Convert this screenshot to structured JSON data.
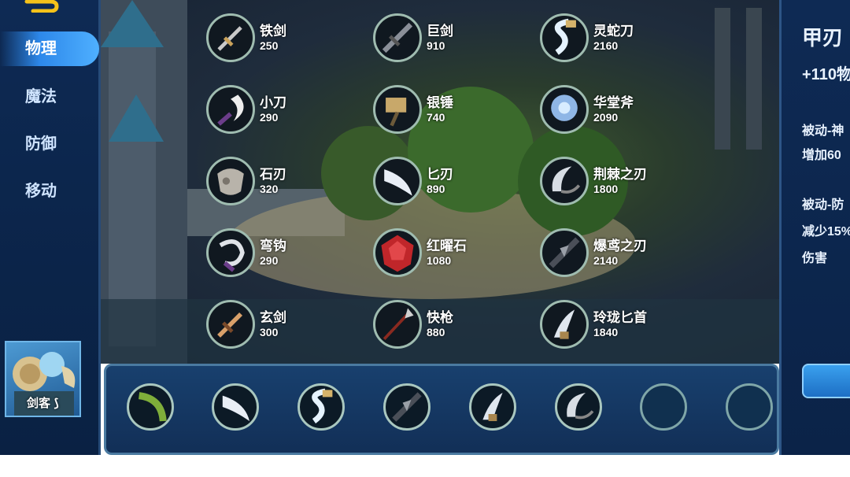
{
  "sidebar": {
    "categories": [
      {
        "label": "物理",
        "active": true
      },
      {
        "label": "魔法",
        "active": false
      },
      {
        "label": "防御",
        "active": false
      },
      {
        "label": "移动",
        "active": false
      }
    ],
    "hero": {
      "name": "剑客"
    }
  },
  "shop": {
    "items": [
      {
        "name": "铁剑",
        "price": "250",
        "icon": "iron-sword-icon"
      },
      {
        "name": "巨剑",
        "price": "910",
        "icon": "great-sword-icon"
      },
      {
        "name": "灵蛇刀",
        "price": "2160",
        "icon": "serpent-blade-icon"
      },
      {
        "name": "小刀",
        "price": "290",
        "icon": "small-knife-icon"
      },
      {
        "name": "银锤",
        "price": "740",
        "icon": "silver-hammer-icon"
      },
      {
        "name": "华堂斧",
        "price": "2090",
        "icon": "ornate-axe-icon"
      },
      {
        "name": "石刃",
        "price": "320",
        "icon": "stone-blade-icon"
      },
      {
        "name": "匕刃",
        "price": "890",
        "icon": "dagger-blade-icon"
      },
      {
        "name": "荆棘之刃",
        "price": "1800",
        "icon": "thorn-blade-icon"
      },
      {
        "name": "弯钩",
        "price": "290",
        "icon": "curved-hook-icon"
      },
      {
        "name": "红曜石",
        "price": "1080",
        "icon": "red-gem-icon"
      },
      {
        "name": "爆鸢之刃",
        "price": "2140",
        "icon": "burst-kite-blade-icon"
      },
      {
        "name": "玄剑",
        "price": "300",
        "icon": "dark-sword-icon"
      },
      {
        "name": "快枪",
        "price": "880",
        "icon": "quick-spear-icon"
      },
      {
        "name": "玲珑匕首",
        "price": "1840",
        "icon": "fine-dagger-icon"
      }
    ]
  },
  "detail": {
    "title": "甲刃",
    "stat": "+110物",
    "passive1_title": "被动-神",
    "passive1_text": "增加60",
    "passive2_title": "被动-防",
    "passive2_text": "减少15%",
    "passive2_text2": "伤害"
  },
  "inventory": {
    "slots": [
      {
        "icon": "green-hook-icon",
        "filled": true
      },
      {
        "icon": "dagger-blade-icon",
        "filled": true
      },
      {
        "icon": "serpent-blade-icon",
        "filled": true
      },
      {
        "icon": "burst-kite-blade-icon",
        "filled": true
      },
      {
        "icon": "fine-dagger-icon",
        "filled": true
      },
      {
        "icon": "thorn-blade-icon",
        "filled": true
      },
      {
        "icon": "empty-slot",
        "filled": false
      },
      {
        "icon": "empty-slot",
        "filled": false
      }
    ]
  }
}
